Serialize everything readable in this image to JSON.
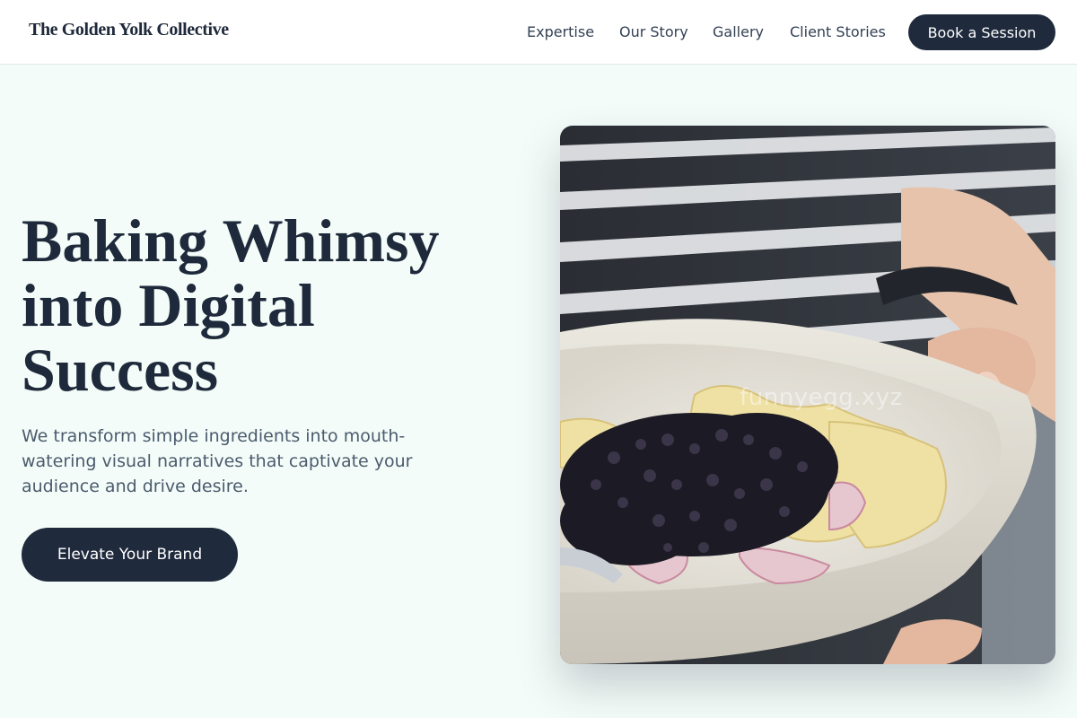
{
  "header": {
    "brand": "The Golden Yolk Collective",
    "nav": [
      "Expertise",
      "Our Story",
      "Gallery",
      "Client Stories"
    ],
    "cta_label": "Book a Session"
  },
  "hero": {
    "headline_lines": [
      "Baking Whimsy",
      "into Digital",
      "Success"
    ],
    "subtext": "We transform simple ingredients into mouth-watering visual narratives that captivate your audience and drive desire.",
    "cta_label": "Elevate Your Brand",
    "image": {
      "subject": "person-holding-bowl-of-pasta-with-blackberries",
      "watermark": "funnyegg.xyz"
    }
  },
  "colors": {
    "background": "#f3fcf8",
    "primary": "#1f2a3d",
    "text": "#1e293b",
    "muted_text": "#4b5b6e"
  }
}
